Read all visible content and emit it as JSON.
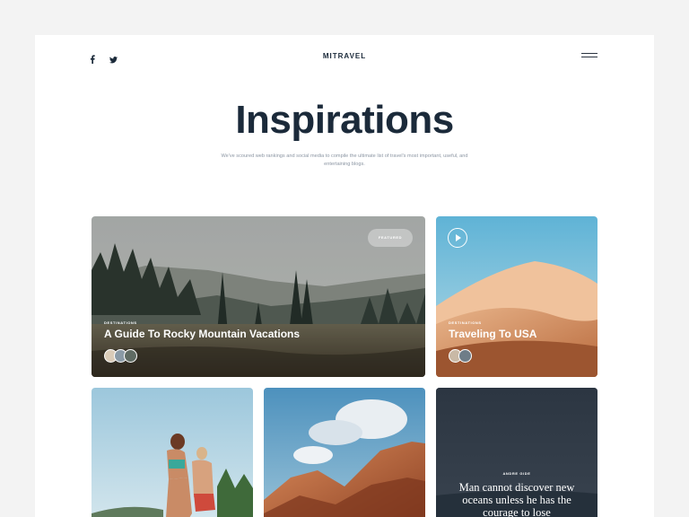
{
  "header": {
    "social": [
      "facebook-icon",
      "twitter-icon"
    ],
    "logo": "MITRAVEL",
    "menu_icon": "hamburger-menu-icon"
  },
  "hero": {
    "title": "Inspirations",
    "subtitle": "We've scoured web rankings and social media to compile the ultimate list of travel's most important, useful, and entertaining blogs."
  },
  "cards": {
    "featured": {
      "badge": "FEATURED",
      "category": "DESTINATIONS",
      "title": "A Guide To Rocky Mountain Vacations"
    },
    "video": {
      "category": "DESTINATIONS",
      "title": "Traveling To USA"
    },
    "quote": {
      "author": "ANDRE GIDE",
      "text": "Man cannot discover new oceans unless he has the courage to lose"
    }
  }
}
